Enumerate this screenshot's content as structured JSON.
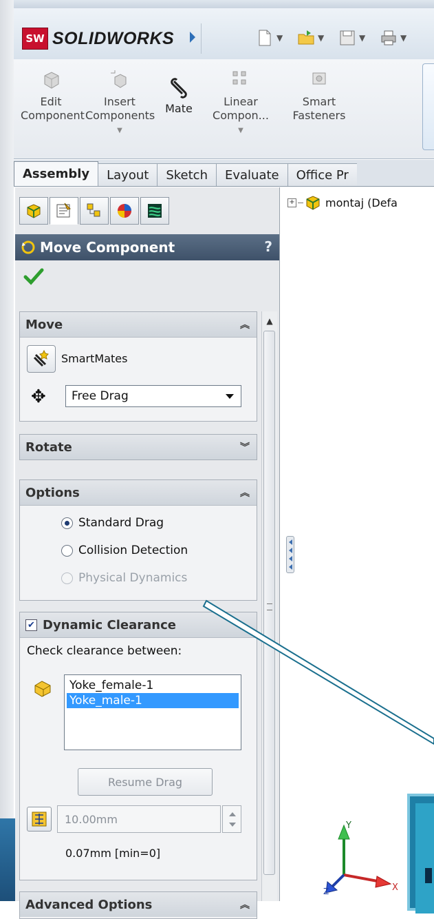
{
  "app": {
    "name": "SOLIDWORKS",
    "badge": "SW"
  },
  "ribbon": {
    "edit_component": "Edit Component",
    "insert_components": "Insert Components",
    "mate": "Mate",
    "linear_component": "Linear Compon...",
    "smart_fasteners": "Smart Fasteners"
  },
  "tabs": [
    "Assembly",
    "Layout",
    "Sketch",
    "Evaluate",
    "Office Pr"
  ],
  "property_manager": {
    "title": "Move Component",
    "help": "?",
    "move": {
      "header": "Move",
      "smartmates": "SmartMates",
      "drag_mode": "Free Drag"
    },
    "rotate": {
      "header": "Rotate"
    },
    "options": {
      "header": "Options",
      "standard_drag": "Standard Drag",
      "collision_detection": "Collision Detection",
      "physical_dynamics": "Physical Dynamics"
    },
    "dynamic_clearance": {
      "header": "Dynamic Clearance",
      "check_label": "Check clearance between:",
      "components": [
        "Yoke_female-1",
        "Yoke_male-1"
      ],
      "resume_drag": "Resume Drag",
      "distance": "10.00mm",
      "measured": "0.07mm [min=0]"
    },
    "advanced": {
      "header": "Advanced Options"
    }
  },
  "tree": {
    "root": "montaj  (Defa"
  },
  "triad": {
    "x_label": "X",
    "y_label": "Y",
    "z_label": "Z"
  },
  "colors": {
    "header_bg": "#4a5d75",
    "selection": "#3399ff",
    "brand": "#c8102e"
  }
}
